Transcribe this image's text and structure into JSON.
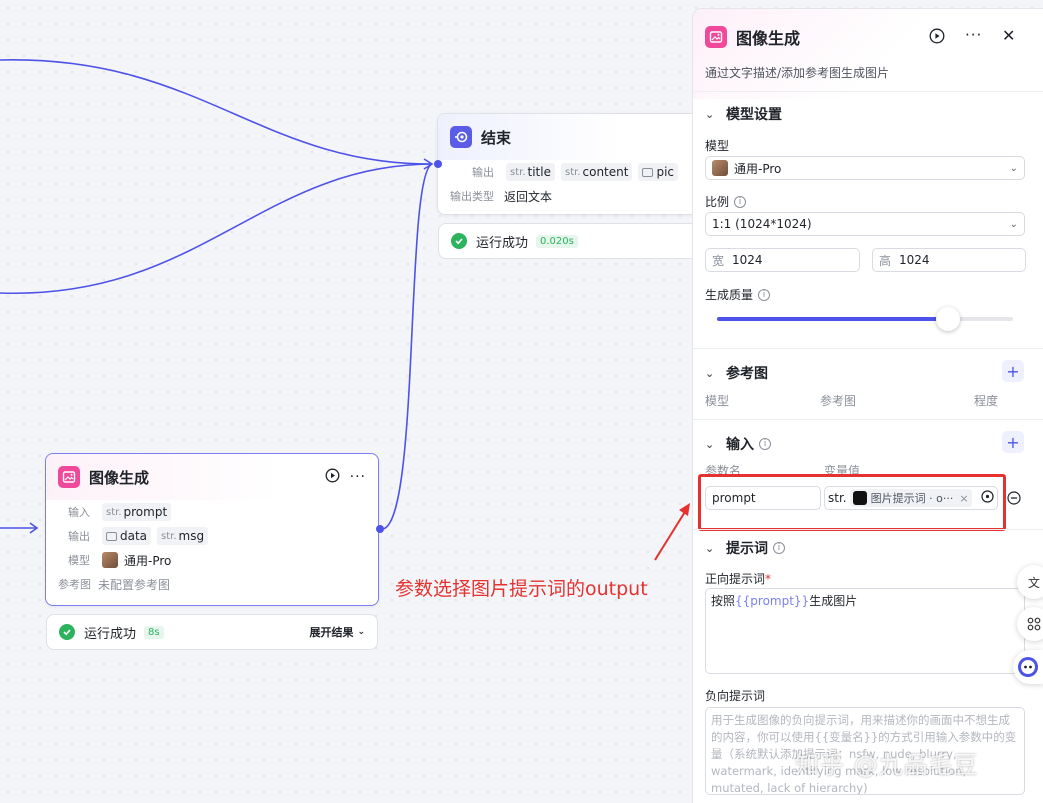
{
  "end_node": {
    "title": "结束",
    "output_label": "输出",
    "outputs": [
      {
        "type": "str.",
        "name": "title"
      },
      {
        "type": "str.",
        "name": "content"
      },
      {
        "type": "img",
        "name": "pic"
      }
    ],
    "output_type_label": "输出类型",
    "output_type_value": "返回文本",
    "status_text": "运行成功",
    "status_time": "0.020s"
  },
  "image_node": {
    "title": "图像生成",
    "input_label": "输入",
    "input_type": "str.",
    "input_name": "prompt",
    "output_label": "输出",
    "output_data": "data",
    "output_msg_type": "str.",
    "output_msg": "msg",
    "model_label": "模型",
    "model_value": "通用-Pro",
    "ref_label": "参考图",
    "ref_value": "未配置参考图",
    "status_text": "运行成功",
    "status_time": "8s",
    "expand_label": "展开结果"
  },
  "annotation": "参数选择图片提示词的output",
  "panel": {
    "title": "图像生成",
    "description": "通过文字描述/添加参考图生成图片",
    "model_settings": {
      "title": "模型设置",
      "model_label": "模型",
      "model_value": "通用-Pro",
      "ratio_label": "比例",
      "ratio_value": "1:1 (1024*1024)",
      "width_label": "宽",
      "width_value": "1024",
      "height_label": "高",
      "height_value": "1024",
      "quality_label": "生成质量",
      "quality_level": 0.78
    },
    "reference": {
      "title": "参考图",
      "col_model": "模型",
      "col_image": "参考图",
      "col_degree": "程度"
    },
    "inputs": {
      "title": "输入",
      "col_name": "参数名",
      "col_value": "变量值",
      "param_name": "prompt",
      "var_prefix": "str.",
      "var_value": "图片提示词 · o···"
    },
    "prompt": {
      "title": "提示词",
      "positive_label": "正向提示词",
      "required_mark": "*",
      "positive_prefix": "按照",
      "positive_var": "{{prompt}}",
      "positive_suffix": "生成图片",
      "negative_label": "负向提示词",
      "negative_placeholder": "用于生成图像的负向提示词，用来描述你的画面中不想生成的内容，你可以使用{{变量名}}的方式引用输入参数中的变量（系统默认添加提示词：nsfw, nude, blurry, watermark, identifying mark, low resolution, mutated, lack of hierarchy)"
    }
  },
  "watermark": "知乎 @九品毛豆",
  "colors": {
    "accent": "#4d53e8",
    "success": "#2bb35d",
    "annotation": "#e5312f",
    "pink": "#f0489a"
  }
}
